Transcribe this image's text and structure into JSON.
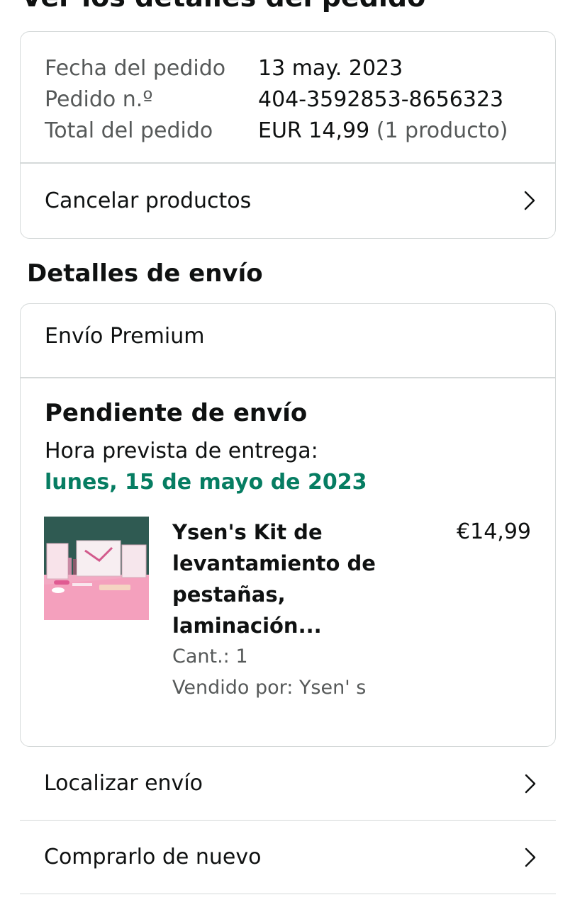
{
  "header": {
    "title": "Ver los detalles del pedido"
  },
  "order_summary": {
    "rows": [
      {
        "label": "Fecha del pedido",
        "value": "13 may. 2023",
        "extra": ""
      },
      {
        "label": "Pedido n.º",
        "value": "404-3592853-8656323",
        "extra": ""
      },
      {
        "label": "Total del pedido",
        "value": "EUR 14,99",
        "extra": "(1 producto)"
      }
    ],
    "cancel_label": "Cancelar productos"
  },
  "shipping": {
    "section_title": "Detalles de envío",
    "method": "Envío Premium",
    "status": "Pendiente de envío",
    "eta_label": "Hora prevista de entrega:",
    "eta_date": "lunes, 15 de mayo de 2023",
    "eta_color": "#067d62",
    "product": {
      "title": "Ysen's Kit de levantamiento de pestañas, laminación...",
      "price": "€14,99",
      "qty": "Cant.: 1",
      "seller": "Vendido por: Ysen' s"
    }
  },
  "actions": {
    "track_label": "Localizar envío",
    "buy_again_label": "Comprarlo de nuevo"
  }
}
